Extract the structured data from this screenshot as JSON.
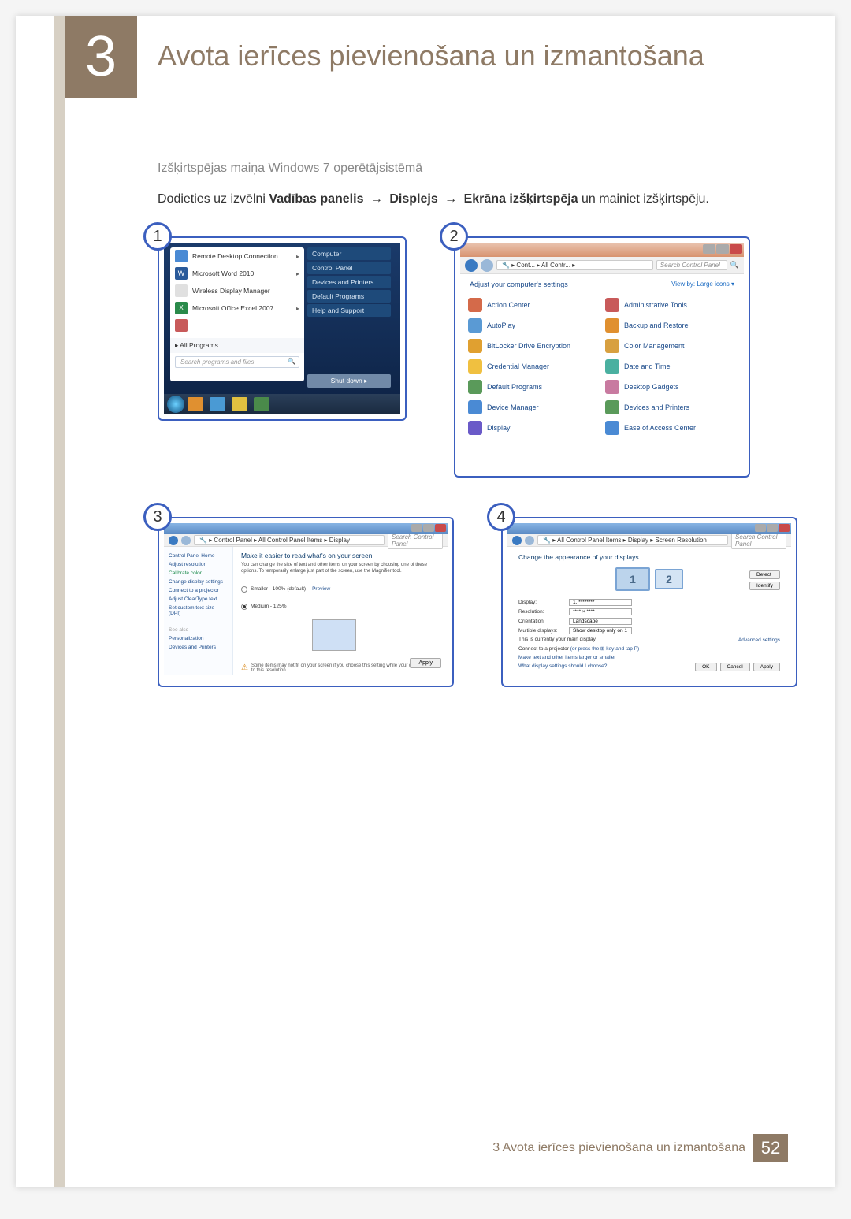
{
  "chapter_number": "3",
  "page_title": "Avota ierīces pievienošana un izmantošana",
  "subtitle": "Izšķirtspējas maiņa Windows 7 operētājsistēmā",
  "instruction": {
    "pre": "Dodieties uz izvēlni ",
    "b1": "Vadības panelis",
    "b2": "Displejs",
    "b3": "Ekrāna izšķirtspēja",
    "post": " un mainiet izšķirtspēju."
  },
  "steps": {
    "s1": "1",
    "s2": "2",
    "s3": "3",
    "s4": "4"
  },
  "start_menu": {
    "items": [
      "Remote Desktop Connection",
      "Microsoft Word 2010",
      "Wireless Display Manager",
      "Microsoft Office Excel 2007"
    ],
    "all_programs": "All Programs",
    "search_placeholder": "Search programs and files",
    "right": [
      "Computer",
      "Control Panel",
      "Devices and Printers",
      "Default Programs",
      "Help and Support"
    ],
    "shutdown": "Shut down"
  },
  "control_panel": {
    "crumb": "▸ Cont... ▸ All Contr... ▸",
    "search": "Search Control Panel",
    "adjust": "Adjust your computer's settings",
    "viewby_label": "View by:",
    "viewby_value": "Large icons ▾",
    "left_col": [
      "Action Center",
      "AutoPlay",
      "BitLocker Drive Encryption",
      "Credential Manager",
      "Default Programs",
      "Device Manager",
      "Display"
    ],
    "right_col": [
      "Administrative Tools",
      "Backup and Restore",
      "Color Management",
      "Date and Time",
      "Desktop Gadgets",
      "Devices and Printers",
      "Ease of Access Center"
    ],
    "icon_colors": [
      "#d46a4a",
      "#5a9ad4",
      "#e0a030",
      "#f0c040",
      "#5a9a5a",
      "#4a8ad4",
      "#6a5ac8",
      "#c85a5a",
      "#e09030",
      "#d8a040",
      "#4ab0a0",
      "#c87aa0",
      "#5a9a5a",
      "#4a8ad4"
    ]
  },
  "display_panel": {
    "crumb": "▸ Control Panel ▸ All Control Panel Items ▸ Display",
    "search": "Search Control Panel",
    "side": {
      "home": "Control Panel Home",
      "links": [
        "Adjust resolution",
        "Calibrate color",
        "Change display settings",
        "Connect to a projector",
        "Adjust ClearType text",
        "Set custom text size (DPI)"
      ],
      "seealso": "See also",
      "personalization": "Personalization",
      "devices": "Devices and Printers"
    },
    "heading": "Make it easier to read what's on your screen",
    "para": "You can change the size of text and other items on your screen by choosing one of these options. To temporarily enlarge just part of the screen, use the Magnifier tool.",
    "r1": "Smaller - 100% (default)",
    "preview": "Preview",
    "r2": "Medium - 125%",
    "warn": "Some items may not fit on your screen if you choose this setting while your display is set to this resolution.",
    "apply": "Apply"
  },
  "resolution_panel": {
    "crumb": "▸ All Control Panel Items ▸ Display ▸ Screen Resolution",
    "search": "Search Control Panel",
    "heading": "Change the appearance of your displays",
    "mon1": "1",
    "mon2": "2",
    "detect": "Detect",
    "identify": "Identify",
    "rows": {
      "display_l": "Display:",
      "display_v": "1. ********",
      "res_l": "Resolution:",
      "res_v": "**** × ****",
      "orient_l": "Orientation:",
      "orient_v": "Landscape",
      "multi_l": "Multiple displays:",
      "multi_v": "Show desktop only on 1"
    },
    "main_display": "This is currently your main display.",
    "advanced": "Advanced settings",
    "projector_pre": "Connect to a projector ",
    "projector_suf": "(or press the ⊞ key and tap P)",
    "make_text": "Make text and other items larger or smaller",
    "what_settings": "What display settings should I choose?",
    "ok": "OK",
    "cancel": "Cancel",
    "apply": "Apply"
  },
  "footer": {
    "text": "3 Avota ierīces pievienošana un izmantošana",
    "page": "52"
  }
}
